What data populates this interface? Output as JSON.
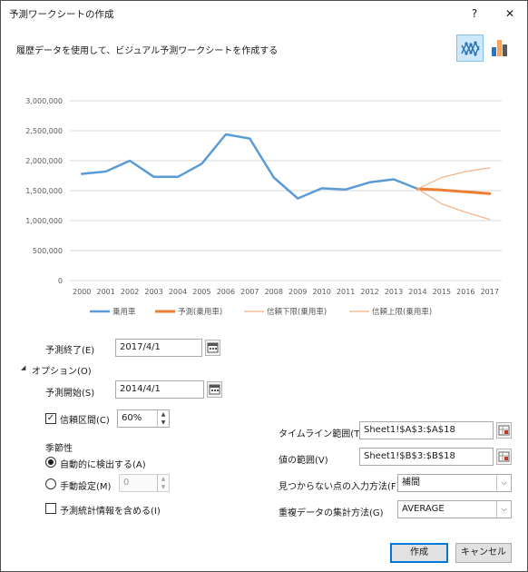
{
  "dialog": {
    "title": "予測ワークシートの作成",
    "help": "?",
    "close": "✕",
    "description": "履歴データを使用して、ビジュアル予測ワークシートを作成する"
  },
  "chart_data": {
    "type": "line",
    "x": [
      "2000",
      "2001",
      "2002",
      "2003",
      "2004",
      "2005",
      "2006",
      "2007",
      "2008",
      "2009",
      "2010",
      "2011",
      "2012",
      "2013",
      "2014",
      "2015",
      "2016",
      "2017"
    ],
    "ylim": [
      0,
      3000000
    ],
    "yticks": [
      "0",
      "500,000",
      "1,000,000",
      "1,500,000",
      "2,000,000",
      "2,500,000",
      "3,000,000"
    ],
    "grid": true,
    "legend_position": "bottom",
    "series": [
      {
        "name": "乗用車",
        "color": "#5b9bd5",
        "values": [
          1780000,
          1820000,
          2000000,
          1730000,
          1730000,
          1950000,
          2440000,
          2370000,
          1720000,
          1370000,
          1540000,
          1520000,
          1640000,
          1690000,
          1530000,
          null,
          null,
          null
        ]
      },
      {
        "name": "予測(乗用車)",
        "color": "#ed7d31",
        "values": [
          null,
          null,
          null,
          null,
          null,
          null,
          null,
          null,
          null,
          null,
          null,
          null,
          null,
          null,
          1530000,
          1510000,
          1480000,
          1450000
        ]
      },
      {
        "name": "信頼下限(乗用車)",
        "color": "#f4b183",
        "values": [
          null,
          null,
          null,
          null,
          null,
          null,
          null,
          null,
          null,
          null,
          null,
          null,
          null,
          null,
          1530000,
          1280000,
          1140000,
          1020000
        ]
      },
      {
        "name": "信頼上限(乗用車)",
        "color": "#f4b183",
        "values": [
          null,
          null,
          null,
          null,
          null,
          null,
          null,
          null,
          null,
          null,
          null,
          null,
          null,
          null,
          1530000,
          1720000,
          1820000,
          1880000
        ]
      }
    ]
  },
  "form": {
    "forecast_end": {
      "label": "予測終了(E)",
      "value": "2017/4/1"
    },
    "options_toggle": {
      "arrow": "◢",
      "label": "オプション(O)"
    },
    "forecast_start": {
      "label": "予測開始(S)",
      "value": "2014/4/1"
    },
    "confidence": {
      "label": "信頼区間(C)",
      "checked": true,
      "check": "✓",
      "value": "60%"
    },
    "seasonality": {
      "label": "季節性",
      "auto": "自動的に検出する(A)",
      "manual": "手動設定(M)",
      "manual_value": "0"
    },
    "include_stats": {
      "label": "予測統計情報を含める(I)"
    },
    "timeline": {
      "label": "タイムライン範囲(T)",
      "value": "Sheet1!$A$3:$A$18"
    },
    "values": {
      "label": "値の範囲(V)",
      "value": "Sheet1!$B$3:$B$18"
    },
    "fill_missing": {
      "label": "見つからない点の入力方法(F)",
      "value": "補間"
    },
    "aggregate": {
      "label": "重複データの集計方法(G)",
      "value": "AVERAGE"
    }
  },
  "buttons": {
    "create": "作成",
    "cancel": "キャンセル"
  },
  "icons": {
    "arrow_up": "▲",
    "arrow_down": "▼",
    "dropdown": "⌵"
  }
}
